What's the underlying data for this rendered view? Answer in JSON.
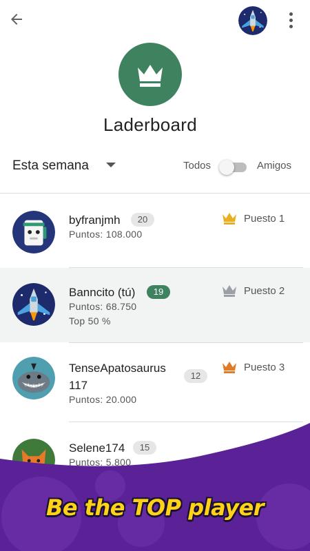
{
  "header": {
    "back_icon": "arrow-back-icon",
    "avatar_icon": "spaceship-avatar-icon",
    "menu_icon": "more-vert-icon"
  },
  "title": "Laderboard",
  "filter": {
    "period": "Esta semana",
    "all_label": "Todos",
    "friends_label": "Amigos",
    "friends_toggle_on": false
  },
  "players": [
    {
      "name": "byfranjmh",
      "level": "20",
      "points": "Puntos: 108.000",
      "extra": "",
      "rank": "Puesto 1",
      "crown_color": "#e8b021",
      "avatar": "robot-avatar-icon"
    },
    {
      "name": "Banncito (tú)",
      "level": "19",
      "points": "Puntos: 68.750",
      "extra": "Top 50 %",
      "rank": "Puesto 2",
      "crown_color": "#9aa0a6",
      "avatar": "spaceship-avatar-icon"
    },
    {
      "name": "TenseApatosaurus 117",
      "level": "12",
      "points": "Puntos: 20.000",
      "extra": "",
      "rank": "Puesto 3",
      "crown_color": "#e07b2a",
      "avatar": "shark-avatar-icon"
    },
    {
      "name": "Selene174",
      "level": "15",
      "points": "Puntos: 5.800",
      "extra": "",
      "rank": "",
      "crown_color": "",
      "avatar": "fox-avatar-icon"
    }
  ],
  "promo": {
    "text": "Be the TOP player",
    "bg_color": "#5b2196"
  }
}
